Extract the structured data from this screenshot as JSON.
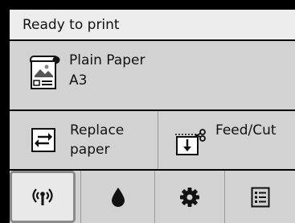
{
  "status": {
    "text": "Ready to print"
  },
  "media": {
    "type": "Plain Paper",
    "size": "A3",
    "icon": "paper-media-icon"
  },
  "buttons": {
    "replace": {
      "line1": "Replace",
      "line2": "paper",
      "icon": "replace-paper-icon"
    },
    "feed": {
      "label": "Feed/Cut",
      "icon": "feed-cut-icon"
    }
  },
  "tabs": [
    {
      "id": "network",
      "icon": "wireless-icon",
      "selected": true
    },
    {
      "id": "ink",
      "icon": "ink-drop-icon"
    },
    {
      "id": "settings",
      "icon": "gear-icon"
    },
    {
      "id": "list",
      "icon": "list-icon"
    }
  ]
}
